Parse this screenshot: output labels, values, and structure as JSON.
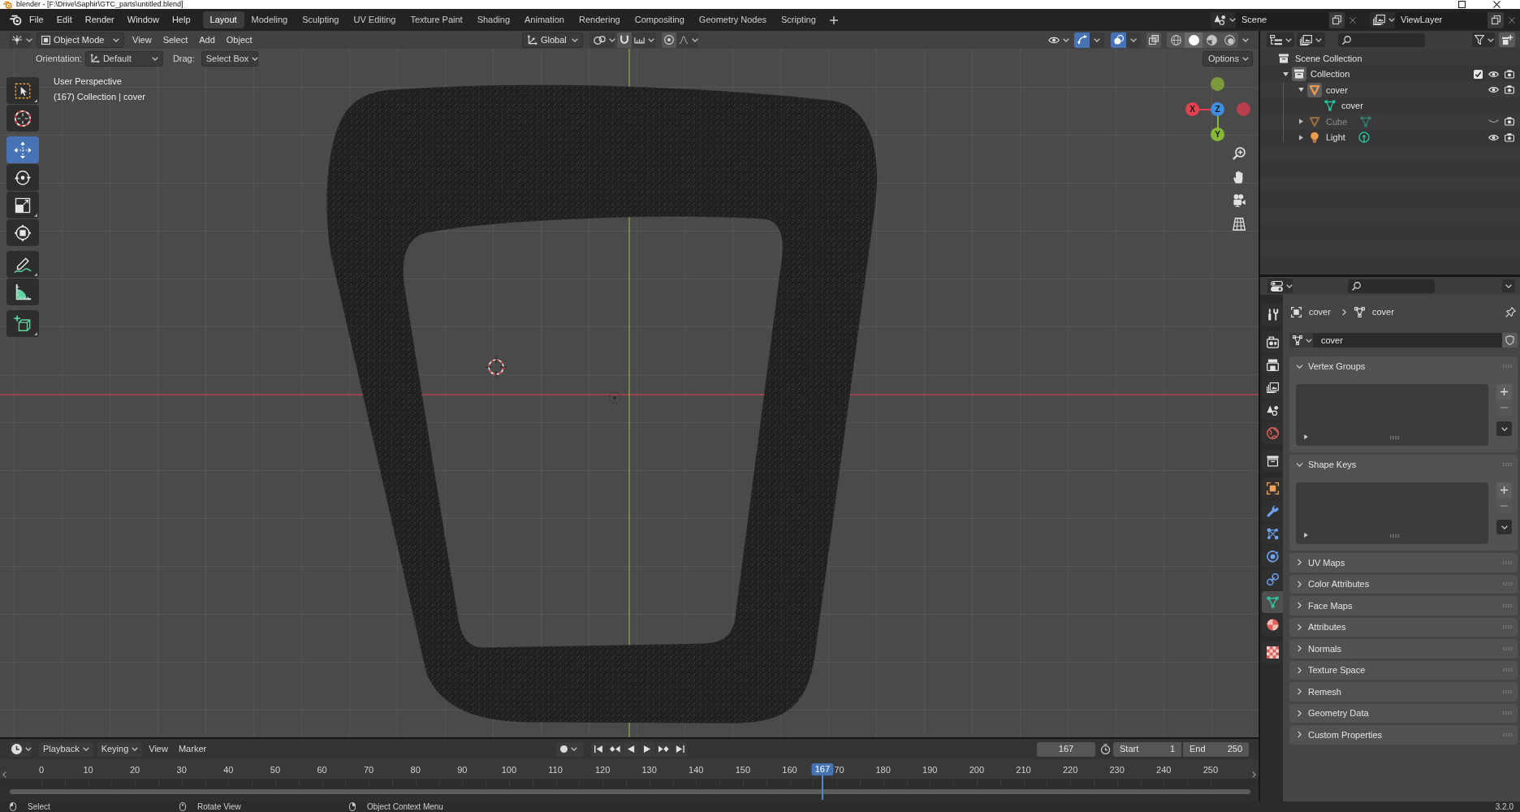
{
  "window": {
    "title": "blender - [F:\\Drive\\Saphir\\GTC_parts\\untitled.blend]",
    "controls": [
      {
        "kind": "maximize"
      },
      {
        "kind": "close"
      }
    ]
  },
  "topbar": {
    "menus": [
      "File",
      "Edit",
      "Render",
      "Window",
      "Help"
    ],
    "workspaces": [
      {
        "label": "Layout",
        "selected": true
      },
      {
        "label": "Modeling",
        "selected": false
      },
      {
        "label": "Sculpting",
        "selected": false
      },
      {
        "label": "UV Editing",
        "selected": false
      },
      {
        "label": "Texture Paint",
        "selected": false
      },
      {
        "label": "Shading",
        "selected": false
      },
      {
        "label": "Animation",
        "selected": false
      },
      {
        "label": "Rendering",
        "selected": false
      },
      {
        "label": "Compositing",
        "selected": false
      },
      {
        "label": "Geometry Nodes",
        "selected": false
      },
      {
        "label": "Scripting",
        "selected": false
      }
    ],
    "scene": "Scene",
    "view_layer": "ViewLayer"
  },
  "viewport": {
    "header": {
      "mode": "Object Mode",
      "menus": [
        "View",
        "Select",
        "Add",
        "Object"
      ],
      "orientation": "Global",
      "snap": {
        "on": false
      },
      "proportional": {
        "on": false
      },
      "gizmos": {
        "on": true
      },
      "overlays": {
        "on": true
      },
      "xray": {
        "on": false
      },
      "shading": [
        {
          "kind": "wireframe",
          "selected": false
        },
        {
          "kind": "solid",
          "selected": true
        },
        {
          "kind": "material",
          "selected": false
        },
        {
          "kind": "rendered",
          "selected": false
        }
      ]
    },
    "tool_settings": {
      "orientation_label": "Orientation:",
      "orientation": "Default",
      "drag_label": "Drag:",
      "drag": "Select Box",
      "options": "Options"
    },
    "overlay_text": [
      "User Perspective",
      "(167) Collection | cover"
    ],
    "tool_groups": [
      {
        "tools": [
          {
            "kind": "select",
            "selected": false,
            "variants": true
          },
          {
            "kind": "cursor",
            "selected": false,
            "variants": false
          }
        ]
      },
      {
        "tools": [
          {
            "kind": "move",
            "selected": true,
            "variants": false
          },
          {
            "kind": "rotate",
            "selected": false,
            "variants": false
          },
          {
            "kind": "scale",
            "selected": false,
            "variants": true
          },
          {
            "kind": "transform",
            "selected": false,
            "variants": false
          }
        ]
      },
      {
        "tools": [
          {
            "kind": "annotate",
            "selected": false,
            "variants": true
          },
          {
            "kind": "measure",
            "selected": false,
            "variants": false
          }
        ]
      },
      {
        "tools": [
          {
            "kind": "add",
            "selected": false,
            "variants": true
          }
        ]
      }
    ],
    "gizmo_axes": [
      {
        "color": "#7e9a3c"
      },
      {
        "label": "X",
        "color": "#e2414f"
      },
      {
        "label": "Z",
        "color": "#3f8de0"
      },
      {
        "color": "#b8404c"
      },
      {
        "label": "Y",
        "color": "#84b836"
      }
    ],
    "nav_buttons": [
      {
        "kind": "zoom"
      },
      {
        "kind": "pan"
      },
      {
        "kind": "camera"
      },
      {
        "kind": "ortho"
      }
    ]
  },
  "outliner": {
    "items": [
      {
        "label": "Scene Collection",
        "kind": "scene_collection",
        "children": [
          {
            "label": "Collection",
            "kind": "collection",
            "expanded": true,
            "active": true,
            "checked": true,
            "visible": true,
            "children": [
              {
                "label": "cover",
                "kind": "mesh_object",
                "expanded": true,
                "active": true,
                "visible": true,
                "children": [
                  {
                    "label": "cover",
                    "kind": "mesh_data"
                  }
                ]
              },
              {
                "label": "Cube",
                "kind": "mesh_object",
                "expanded": false,
                "active": false,
                "visible": false,
                "children": [
                  {
                    "kind": "mesh_data"
                  }
                ]
              },
              {
                "label": "Light",
                "kind": "light_object",
                "expanded": false,
                "active": false,
                "visible": true,
                "children": [
                  {
                    "kind": "light_data"
                  }
                ]
              }
            ]
          }
        ]
      }
    ]
  },
  "properties": {
    "tab_groups": [
      {
        "tabs": [
          {
            "kind": "tool",
            "selected": false
          }
        ]
      },
      {
        "tabs": [
          {
            "kind": "render",
            "selected": false
          },
          {
            "kind": "output",
            "selected": false
          },
          {
            "kind": "view_layer",
            "selected": false
          },
          {
            "kind": "scene",
            "selected": false
          },
          {
            "kind": "world",
            "selected": false
          }
        ]
      },
      {
        "tabs": [
          {
            "kind": "collection",
            "selected": false
          }
        ]
      },
      {
        "tabs": [
          {
            "kind": "object",
            "selected": false
          },
          {
            "kind": "modifiers",
            "selected": false
          },
          {
            "kind": "particles",
            "selected": false
          },
          {
            "kind": "physics",
            "selected": false
          },
          {
            "kind": "constraints",
            "selected": false
          },
          {
            "kind": "data",
            "selected": true
          },
          {
            "kind": "material",
            "selected": false
          }
        ]
      },
      {
        "tabs": [
          {
            "kind": "texture",
            "selected": false
          }
        ]
      }
    ],
    "breadcrumb": [
      {
        "kind": "object",
        "label": "cover"
      },
      {
        "kind": "mesh",
        "label": "cover"
      }
    ],
    "datablock": "cover",
    "panels": [
      {
        "label": "Vertex Groups",
        "expanded": true
      },
      {
        "label": "Shape Keys",
        "expanded": true
      },
      {
        "label": "UV Maps",
        "expanded": false
      },
      {
        "label": "Color Attributes",
        "expanded": false
      },
      {
        "label": "Face Maps",
        "expanded": false
      },
      {
        "label": "Attributes",
        "expanded": false
      },
      {
        "label": "Normals",
        "expanded": false
      },
      {
        "label": "Texture Space",
        "expanded": false
      },
      {
        "label": "Remesh",
        "expanded": false
      },
      {
        "label": "Geometry Data",
        "expanded": false
      },
      {
        "label": "Custom Properties",
        "expanded": false
      }
    ]
  },
  "timeline": {
    "menus": [
      {
        "label": "Playback",
        "kind": "dropdown"
      },
      {
        "label": "Keying",
        "kind": "dropdown"
      },
      {
        "label": "View",
        "kind": "menu"
      },
      {
        "label": "Marker",
        "kind": "menu"
      }
    ],
    "auto_keying": {
      "on": false
    },
    "transport": [
      {
        "kind": "jump_start"
      },
      {
        "kind": "prev_key"
      },
      {
        "kind": "play_reverse"
      },
      {
        "kind": "play"
      },
      {
        "kind": "next_key"
      },
      {
        "kind": "jump_end"
      }
    ],
    "current_frame": "167",
    "start": {
      "label": "Start",
      "value": "1"
    },
    "end": {
      "label": "End",
      "value": "250"
    },
    "ruler": {
      "ticks": [
        "0",
        "10",
        "20",
        "30",
        "40",
        "50",
        "60",
        "70",
        "80",
        "90",
        "100",
        "110",
        "120",
        "130",
        "140",
        "150",
        "160",
        "70",
        "180",
        "190",
        "200",
        "210",
        "220",
        "230",
        "240",
        "250"
      ],
      "playhead": {
        "label": "167",
        "level": 0.668
      }
    }
  },
  "status_bar": {
    "hints": [
      {
        "kind": "left_click",
        "label": "Select"
      },
      {
        "kind": "middle_click",
        "label": "Rotate View"
      },
      {
        "kind": "right_click",
        "label": "Object Context Menu"
      }
    ],
    "version": "3.2.0"
  }
}
